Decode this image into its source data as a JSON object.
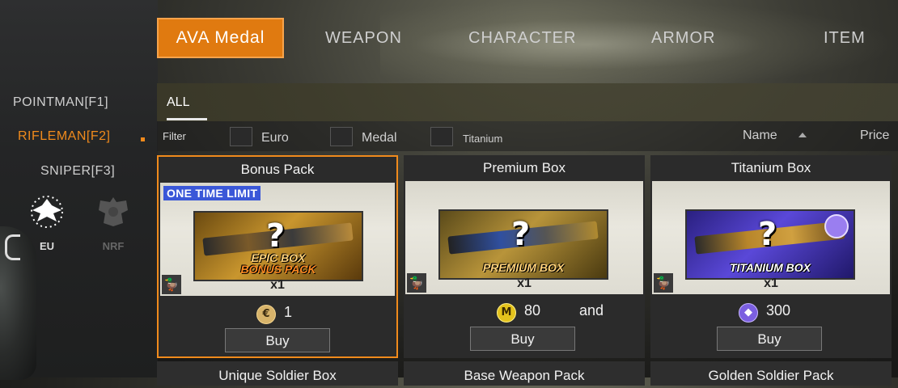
{
  "tabs": [
    "AVA Medal",
    "WEAPON",
    "CHARACTER",
    "ARMOR",
    "ITEM"
  ],
  "side": {
    "items": [
      "POINTMAN[F1]",
      "RIFLEMAN[F2]",
      "SNIPER[F3]"
    ],
    "active_index": 1,
    "factions": [
      "EU",
      "NRF"
    ]
  },
  "subtabs": [
    "ALL"
  ],
  "filter": {
    "label": "Filter",
    "options": [
      "Euro",
      "Medal",
      "Titanium"
    ],
    "sort_name": "Name",
    "sort_price": "Price"
  },
  "cards": [
    {
      "title": "Bonus Pack",
      "badge": "ONE TIME LIMIT",
      "caption1": "EPIC BOX",
      "caption2": "BONUS PACK",
      "qty": "x1",
      "price": "1",
      "currency": "euro-icon",
      "conjunction": "",
      "buy": "Buy"
    },
    {
      "title": "Premium Box",
      "badge": "",
      "caption1": "PREMIUM BOX",
      "caption2": "",
      "qty": "x1",
      "price": "80",
      "currency": "medal-icon",
      "conjunction": "and",
      "buy": "Buy"
    },
    {
      "title": "Titanium Box",
      "badge": "",
      "caption1": "TITANIUM BOX",
      "caption2": "",
      "qty": "x1",
      "price": "300",
      "currency": "titanium-icon",
      "conjunction": "",
      "buy": "Buy"
    }
  ],
  "bottom_cards": [
    "Unique Soldier Box",
    "Base Weapon Pack",
    "Golden Soldier Pack"
  ],
  "colors": {
    "accent": "#e07a10",
    "badge": "#3a57d8"
  }
}
